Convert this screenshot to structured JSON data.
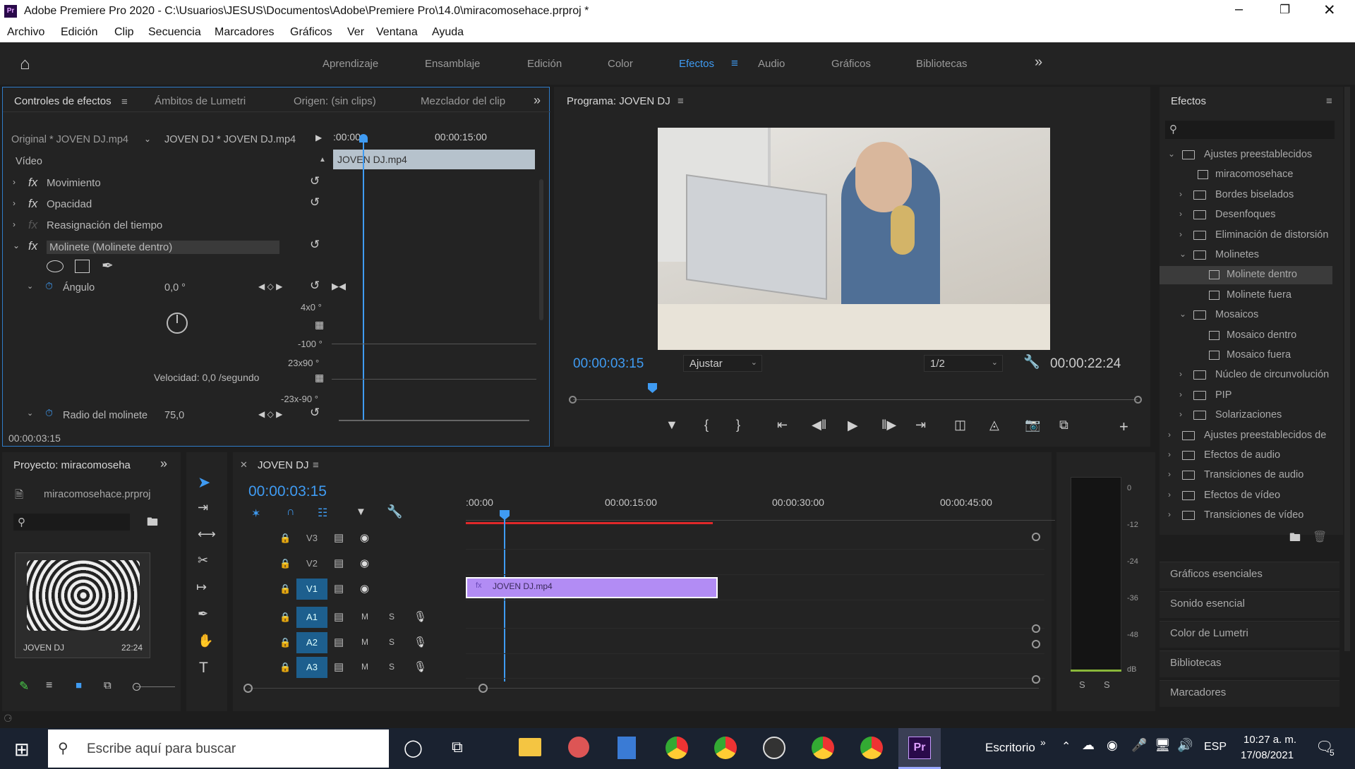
{
  "window": {
    "title": "Adobe Premiere Pro 2020 - C:\\Usuarios\\JESUS\\Documentos\\Adobe\\Premiere Pro\\14.0\\miracomosehace.prproj *"
  },
  "menu": [
    "Archivo",
    "Edición",
    "Clip",
    "Secuencia",
    "Marcadores",
    "Gráficos",
    "Ver",
    "Ventana",
    "Ayuda"
  ],
  "workspaces": [
    "Aprendizaje",
    "Ensamblaje",
    "Edición",
    "Color",
    "Efectos",
    "Audio",
    "Gráficos",
    "Bibliotecas"
  ],
  "effect_controls": {
    "tabs": [
      "Controles de efectos",
      "Ámbitos de Lumetri",
      "Origen: (sin clips)",
      "Mezclador del clip"
    ],
    "source": "Original * JOVEN DJ.mp4",
    "sequence": "JOVEN DJ * JOVEN DJ.mp4",
    "time_start": ":00:00",
    "time_mid": "00:00:15:00",
    "clip": "JOVEN DJ.mp4",
    "section": "Vídeo",
    "effects": [
      "Movimiento",
      "Opacidad",
      "Reasignación del tiempo",
      "Molinete (Molinete dentro)"
    ],
    "angle_label": "Ángulo",
    "angle_value": "0,0 °",
    "graph_top": "4x0 °",
    "graph_mid": "-100 °",
    "graph_mid2": "23x90 °",
    "graph_bot": "-23x-90 °",
    "velocity": "Velocidad: 0,0 /segundo",
    "radius_label": "Radio del molinete",
    "radius_value": "75,0",
    "timecode": "00:00:03:15"
  },
  "program": {
    "title": "Programa: JOVEN DJ",
    "timecode": "00:00:03:15",
    "fit": "Ajustar",
    "quality": "1/2",
    "duration": "00:00:22:24"
  },
  "effects_panel": {
    "title": "Efectos",
    "items": [
      {
        "label": "Ajustes preestablecidos",
        "kind": "folder",
        "indent": 0,
        "open": true
      },
      {
        "label": "miracomosehace",
        "kind": "preset",
        "indent": 1
      },
      {
        "label": "Bordes biselados",
        "kind": "folder",
        "indent": 1
      },
      {
        "label": "Desenfoques",
        "kind": "folder",
        "indent": 1
      },
      {
        "label": "Eliminación de distorsión",
        "kind": "folder",
        "indent": 1
      },
      {
        "label": "Molinetes",
        "kind": "folder",
        "indent": 1,
        "open": true
      },
      {
        "label": "Molinete dentro",
        "kind": "preset",
        "indent": 2,
        "selected": true
      },
      {
        "label": "Molinete fuera",
        "kind": "preset",
        "indent": 2
      },
      {
        "label": "Mosaicos",
        "kind": "folder",
        "indent": 1,
        "open": true
      },
      {
        "label": "Mosaico dentro",
        "kind": "preset",
        "indent": 2
      },
      {
        "label": "Mosaico fuera",
        "kind": "preset",
        "indent": 2
      },
      {
        "label": "Núcleo de circunvolución",
        "kind": "folder",
        "indent": 1
      },
      {
        "label": "PIP",
        "kind": "folder",
        "indent": 1
      },
      {
        "label": "Solarizaciones",
        "kind": "folder",
        "indent": 1
      },
      {
        "label": "Ajustes preestablecidos de",
        "kind": "folder",
        "indent": 0
      },
      {
        "label": "Efectos de audio",
        "kind": "folder",
        "indent": 0
      },
      {
        "label": "Transiciones de audio",
        "kind": "folder",
        "indent": 0
      },
      {
        "label": "Efectos de vídeo",
        "kind": "folder",
        "indent": 0
      },
      {
        "label": "Transiciones de vídeo",
        "kind": "folder",
        "indent": 0
      }
    ],
    "bottom": [
      "Gráficos esenciales",
      "Sonido esencial",
      "Color de Lumetri",
      "Bibliotecas",
      "Marcadores"
    ]
  },
  "project": {
    "title": "Proyecto: miracomoseha",
    "file": "miracomosehace.prproj",
    "clip_name": "JOVEN DJ",
    "clip_duration": "22:24"
  },
  "timeline": {
    "title": "JOVEN DJ",
    "timecode": "00:00:03:15",
    "ruler": [
      ":00:00",
      "00:00:15:00",
      "00:00:30:00",
      "00:00:45:00"
    ],
    "tracks": [
      "V3",
      "V2",
      "V1",
      "A1",
      "A2",
      "A3"
    ],
    "clip": "JOVEN DJ.mp4",
    "meter": [
      "0",
      "-12",
      "-24",
      "-36",
      "-48",
      "dB"
    ]
  },
  "taskbar": {
    "search": "Escribe aquí para buscar",
    "desktop": "Escritorio",
    "lang": "ESP",
    "time": "10:27 a. m.",
    "date": "17/08/2021",
    "notif": "5"
  }
}
